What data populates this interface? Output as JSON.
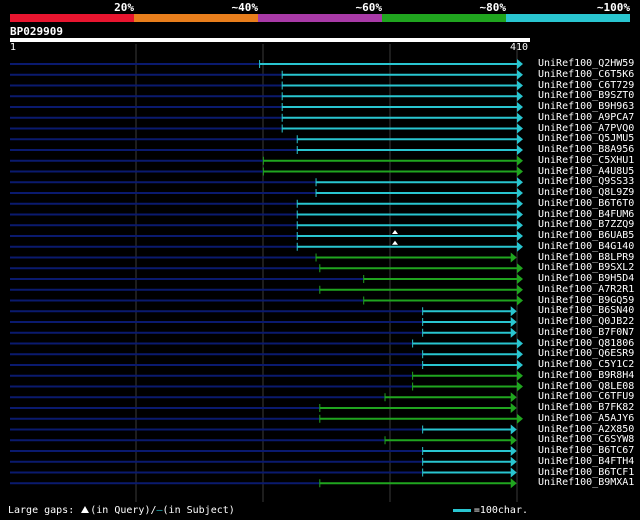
{
  "legend": {
    "labels": [
      "20%",
      "~40%",
      "~60%",
      "~80%",
      "~100%"
    ],
    "colors": [
      "#e8152f",
      "#e87e1c",
      "#a93aa7",
      "#20a51f",
      "#29c5d0"
    ]
  },
  "query": {
    "title": "BP029909",
    "start_label": "1",
    "end_label": "410",
    "length": 410
  },
  "hits": [
    {
      "name": "UniRef100_Q2HW59",
      "start": 200,
      "color": "cyan"
    },
    {
      "name": "UniRef100_C6T5K6",
      "start": 218,
      "color": "cyan"
    },
    {
      "name": "UniRef100_C6T729",
      "start": 218,
      "color": "cyan"
    },
    {
      "name": "UniRef100_B9SZT0",
      "start": 218,
      "color": "cyan"
    },
    {
      "name": "UniRef100_B9H963",
      "start": 218,
      "color": "cyan"
    },
    {
      "name": "UniRef100_A9PCA7",
      "start": 218,
      "color": "cyan"
    },
    {
      "name": "UniRef100_A7PVQ0",
      "start": 218,
      "color": "cyan"
    },
    {
      "name": "UniRef100_Q5JMU5",
      "start": 230,
      "color": "cyan"
    },
    {
      "name": "UniRef100_B8A956",
      "start": 230,
      "color": "cyan"
    },
    {
      "name": "UniRef100_C5XHU1",
      "start": 203,
      "color": "green"
    },
    {
      "name": "UniRef100_A4U8U5",
      "start": 203,
      "color": "green"
    },
    {
      "name": "UniRef100_Q9SS33",
      "start": 245,
      "color": "cyan"
    },
    {
      "name": "UniRef100_Q8L9Z9",
      "start": 245,
      "color": "cyan"
    },
    {
      "name": "UniRef100_B6T6T0",
      "start": 230,
      "color": "cyan"
    },
    {
      "name": "UniRef100_B4FUM6",
      "start": 230,
      "color": "cyan"
    },
    {
      "name": "UniRef100_B7ZZQ9",
      "start": 230,
      "color": "cyan",
      "gap": false
    },
    {
      "name": "UniRef100_B6UAB5",
      "start": 230,
      "color": "cyan",
      "gap": true
    },
    {
      "name": "UniRef100_B4G140",
      "start": 230,
      "color": "cyan",
      "gap": true
    },
    {
      "name": "UniRef100_B8LPR9",
      "start": 245,
      "color": "green",
      "end": 405
    },
    {
      "name": "UniRef100_B9SXL2",
      "start": 248,
      "color": "green"
    },
    {
      "name": "UniRef100_B9H5D4",
      "start": 283,
      "color": "green"
    },
    {
      "name": "UniRef100_A7R2R1",
      "start": 248,
      "color": "green"
    },
    {
      "name": "UniRef100_B9GQ59",
      "start": 283,
      "color": "green"
    },
    {
      "name": "UniRef100_B6SN40",
      "start": 330,
      "color": "cyan",
      "end": 405
    },
    {
      "name": "UniRef100_Q0JB22",
      "start": 330,
      "color": "cyan",
      "end": 405
    },
    {
      "name": "UniRef100_B7F0N7",
      "start": 330,
      "color": "cyan",
      "end": 405
    },
    {
      "name": "UniRef100_Q81806",
      "start": 322,
      "color": "cyan"
    },
    {
      "name": "UniRef100_Q6ESR9",
      "start": 330,
      "color": "cyan"
    },
    {
      "name": "UniRef100_C5Y1C2",
      "start": 330,
      "color": "cyan"
    },
    {
      "name": "UniRef100_B9R8H4",
      "start": 322,
      "color": "green"
    },
    {
      "name": "UniRef100_Q8LE08",
      "start": 322,
      "color": "green"
    },
    {
      "name": "UniRef100_C6TFU9",
      "start": 300,
      "color": "green",
      "end": 405
    },
    {
      "name": "UniRef100_B7FK82",
      "start": 248,
      "color": "green",
      "end": 405
    },
    {
      "name": "UniRef100_A5AJY6",
      "start": 248,
      "color": "green"
    },
    {
      "name": "UniRef100_A2X850",
      "start": 330,
      "color": "cyan",
      "end": 405
    },
    {
      "name": "UniRef100_C6SYW8",
      "start": 300,
      "color": "green",
      "end": 405
    },
    {
      "name": "UniRef100_B6TC67",
      "start": 330,
      "color": "cyan",
      "end": 405
    },
    {
      "name": "UniRef100_B4FTH4",
      "start": 330,
      "color": "cyan",
      "end": 405
    },
    {
      "name": "UniRef100_B6TCF1",
      "start": 330,
      "color": "cyan",
      "end": 405
    },
    {
      "name": "UniRef100_B9MXA1",
      "start": 248,
      "color": "green",
      "end": 405
    }
  ],
  "colors": {
    "cyan": "#29c5d0",
    "green": "#20a51f",
    "unaligned": "#0a1a6e",
    "grid": "#3a3a3a"
  },
  "footer": {
    "large_gaps_prefix": "Large gaps:",
    "in_query": "(in Query)/",
    "in_subject": "(in Subject)",
    "scale_text": "=100char."
  }
}
